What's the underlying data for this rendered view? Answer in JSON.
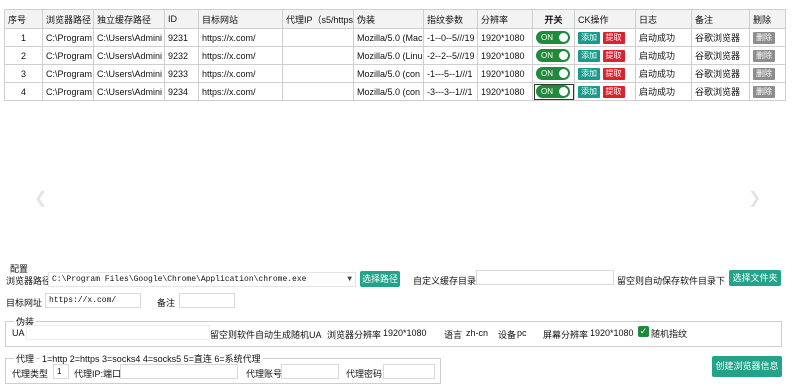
{
  "grid": {
    "headers": [
      "序号",
      "浏览器路径",
      "独立缓存路径",
      "ID",
      "目标网站",
      "代理IP（s5/https",
      "伪装",
      "指纹参数",
      "分辨率",
      "开关",
      "CK操作",
      "日志",
      "备注",
      "删除"
    ],
    "rows": [
      {
        "no": "1",
        "browser_path": "C:\\Program",
        "cache_path": "C:\\Users\\Admini",
        "id": "9231",
        "site": "https://x.com/",
        "proxy": "",
        "ua": "Mozilla/5.0 (Mac",
        "fp": "-1--0--5///19",
        "res": "1920*1080",
        "toggle": "ON",
        "add": "添加",
        "fetch": "提取",
        "log": "启动成功",
        "remark": "谷歌浏览器",
        "del": "删除"
      },
      {
        "no": "2",
        "browser_path": "C:\\Program",
        "cache_path": "C:\\Users\\Admini",
        "id": "9232",
        "site": "https://x.com/",
        "proxy": "",
        "ua": "Mozilla/5.0 (Linu",
        "fp": "-2--2--5///19",
        "res": "1920*1080",
        "toggle": "ON",
        "add": "添加",
        "fetch": "提取",
        "log": "启动成功",
        "remark": "谷歌浏览器",
        "del": "删除"
      },
      {
        "no": "3",
        "browser_path": "C:\\Program",
        "cache_path": "C:\\Users\\Admini",
        "id": "9233",
        "site": "https://x.com/",
        "proxy": "",
        "ua": "Mozilla/5.0 (con",
        "fp": "-1---5--1///1",
        "res": "1920*1080",
        "toggle": "ON",
        "add": "添加",
        "fetch": "提取",
        "log": "启动成功",
        "remark": "谷歌浏览器",
        "del": "删除"
      },
      {
        "no": "4",
        "browser_path": "C:\\Program",
        "cache_path": "C:\\Users\\Admini",
        "id": "9234",
        "site": "https://x.com/",
        "proxy": "",
        "ua": "Mozilla/5.0 (con",
        "fp": "-3---3--1///1",
        "res": "1920*1080",
        "toggle": "ON",
        "add": "添加",
        "fetch": "提取",
        "log": "启动成功",
        "remark": "谷歌浏览器",
        "del": "删除"
      }
    ]
  },
  "config": {
    "section_title": "配置",
    "browser_path_label": "浏览器路径",
    "browser_path_value": "C:\\Program Files\\Google\\Chrome\\Application\\chrome.exe",
    "select_path_button": "选择路径",
    "custom_cache_label": "自定义缓存目录",
    "custom_cache_value": "",
    "cache_hint": "留空则自动保存软件目录下",
    "select_folder_button": "选择文件夹",
    "target_site_label": "目标网址",
    "target_site_value": "https://x.com/",
    "remark_label": "备注",
    "remark_value": ""
  },
  "disguise": {
    "group_title": "伪装",
    "ua_label": "UA",
    "ua_hint": "留空则软件自动生成随机UA",
    "browser_res_label": "浏览器分辨率",
    "browser_res_value": "1920*1080",
    "lang_label": "语言",
    "lang_value": "zh-cn",
    "device_label": "设备",
    "device_value": "pc",
    "screen_res_label": "屏幕分辨率",
    "screen_res_value": "1920*1080",
    "random_fp_label": "随机指纹",
    "random_fp_checked": true
  },
  "proxy": {
    "group_title": "代理",
    "legend": "1=http 2=https 3=socks4 4=socks5 5=直连 6=系统代理",
    "type_label": "代理类型",
    "type_value": "1",
    "ip_label": "代理IP:端口",
    "account_label": "代理账号",
    "password_label": "代理密码"
  },
  "create_button": "创建浏览器信息",
  "colors": {
    "accent": "#22a38a",
    "toggle_on": "#1f8a3b",
    "danger": "#d9232d",
    "disabled": "#8e8e8e"
  }
}
